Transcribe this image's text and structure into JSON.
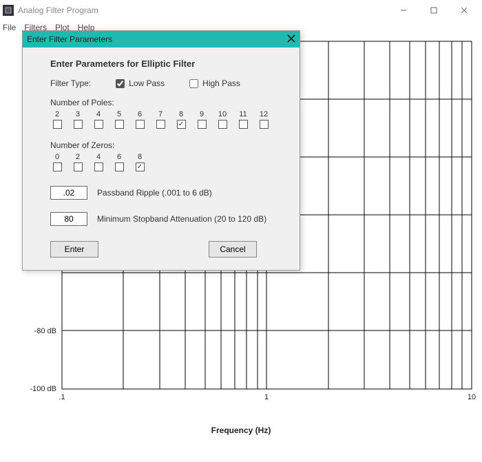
{
  "window": {
    "title": "Analog Filter Program"
  },
  "menu": {
    "file": "File",
    "filters": "Filters",
    "plot": "Plot",
    "help": "Help"
  },
  "dialog": {
    "title": "Enter Filter Parameters",
    "heading": "Enter Parameters for Elliptic Filter",
    "filter_type_label": "Filter Type:",
    "low_pass": "Low Pass",
    "high_pass": "High Pass",
    "filter_type_value": "low",
    "poles_label": "Number of Poles:",
    "poles_options": [
      "2",
      "3",
      "4",
      "5",
      "6",
      "7",
      "8",
      "9",
      "10",
      "11",
      "12"
    ],
    "poles_value": "8",
    "zeros_label": "Number of Zeros:",
    "zeros_options": [
      "0",
      "2",
      "4",
      "6",
      "8"
    ],
    "zeros_value": "8",
    "ripple_value": ".02",
    "ripple_label": "Passband Ripple (.001 to 6 dB)",
    "atten_value": "80",
    "atten_label": "Minimum Stopband Attenuation (20 to 120 dB)",
    "enter": "Enter",
    "cancel": "Cancel"
  },
  "chart_data": {
    "type": "line",
    "title": "",
    "xlabel": "Frequency (Hz)",
    "ylabel": "",
    "x_scale": "log",
    "x_ticks": [
      ".1",
      "1",
      "10"
    ],
    "xlim": [
      0.1,
      10
    ],
    "y_ticks": [
      "-80 dB",
      "-100 dB"
    ],
    "y_tick_values": [
      -80,
      -100
    ],
    "ylim_visible": [
      -100,
      20
    ],
    "series": []
  }
}
